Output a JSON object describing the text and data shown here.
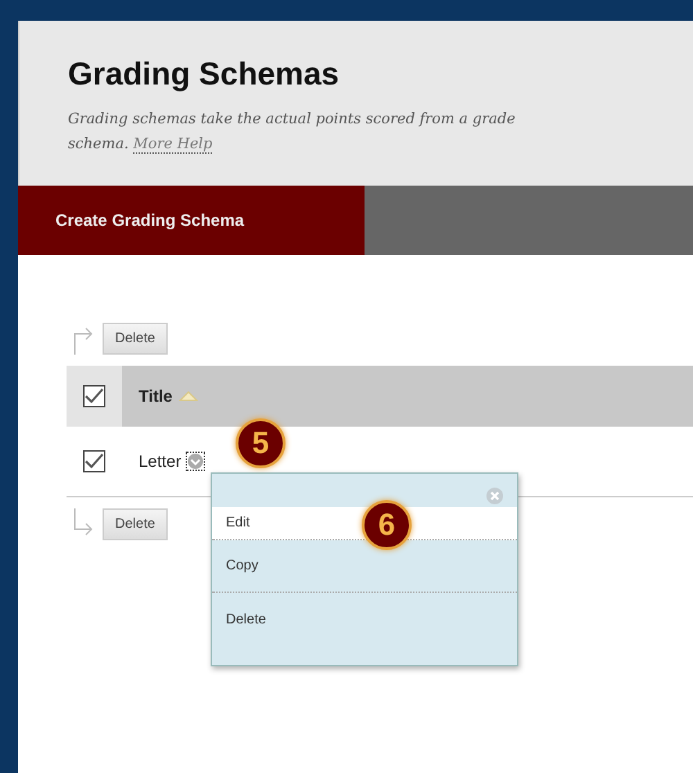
{
  "header": {
    "title": "Grading Schemas",
    "description": "Grading schemas take the actual points scored from a grade",
    "description_end": "schema.",
    "help_link": "More Help"
  },
  "action_bar": {
    "buttons": [
      "Create Grading Schema"
    ]
  },
  "top_delete": "Delete",
  "table": {
    "header": {
      "checked": true,
      "title": "Title",
      "sort_ascending": true
    },
    "rows": [
      {
        "title": "Letter",
        "checked": true
      }
    ]
  },
  "bottom_delete": "Delete",
  "context_menu": {
    "items": [
      {
        "label": "Edit",
        "selected": true
      },
      {
        "label": "Copy",
        "selected": false
      },
      {
        "label": "Delete",
        "selected": false
      }
    ]
  },
  "callouts": [
    "5",
    "6"
  ]
}
